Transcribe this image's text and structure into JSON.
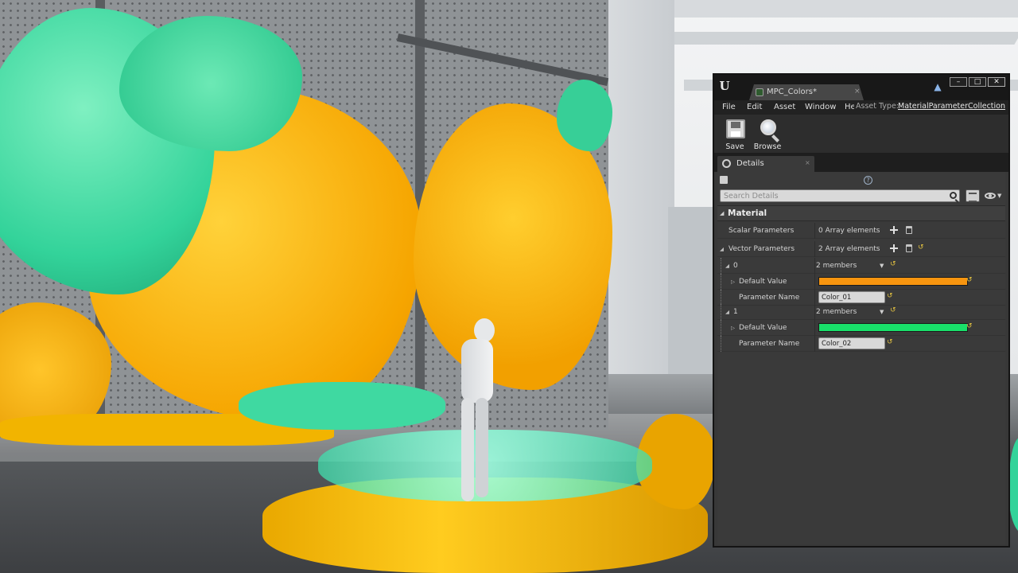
{
  "window": {
    "asset_tab_label": "MPC_Colors*",
    "tab_close": "×",
    "controls": {
      "minimize": "–",
      "maximize": "□",
      "close": "✕"
    }
  },
  "menu": {
    "items": [
      "File",
      "Edit",
      "Asset",
      "Window",
      "Help"
    ],
    "asset_type_label": "Asset Type:",
    "asset_type_value": "MaterialParameterCollection"
  },
  "toolbar": {
    "save_label": "Save",
    "browse_label": "Browse"
  },
  "details": {
    "tab_label": "Details",
    "tab_close": "×",
    "help_glyph": "?",
    "search_placeholder": "Search Details",
    "category_label": "Material",
    "scalar_parameters": {
      "label": "Scalar Parameters",
      "value": "0 Array elements"
    },
    "vector_parameters": {
      "label": "Vector Parameters",
      "value": "2 Array elements"
    },
    "elements": [
      {
        "index": "0",
        "members": "2 members",
        "default_value_label": "Default Value",
        "default_color": "#f7950f",
        "parameter_name_label": "Parameter Name",
        "parameter_name": "Color_01"
      },
      {
        "index": "1",
        "members": "2 members",
        "default_value_label": "Default Value",
        "default_color": "#19e06a",
        "parameter_name_label": "Parameter Name",
        "parameter_name": "Color_02"
      }
    ]
  },
  "icons": {
    "reset": "↺",
    "expanded": "◢",
    "collapsed": "▷",
    "caret": "▼"
  },
  "colors": {
    "panel_bg": "#383838",
    "titlebar_bg": "#181818",
    "reset_arrow": "#e4c341"
  }
}
